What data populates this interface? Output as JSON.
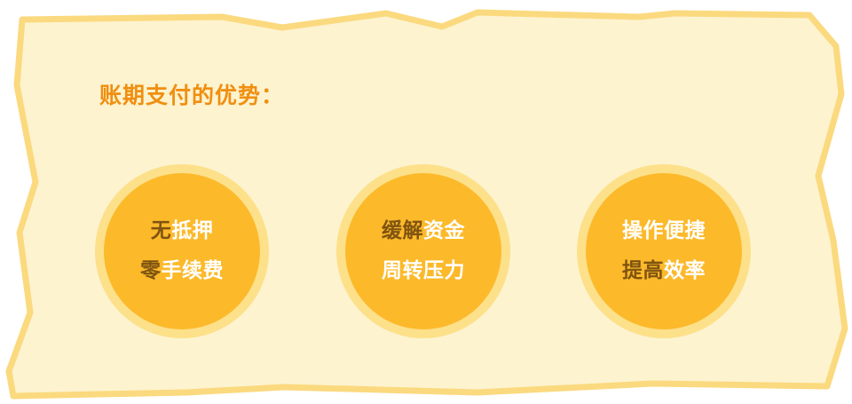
{
  "title": "账期支付的优势：",
  "colors": {
    "paper_fill": "#fdf3cf",
    "paper_border": "#fbd97e",
    "title": "#f08f10",
    "badge_outer": "#fde08a",
    "badge_inner": "#fcb92a",
    "text_dark": "#7f5410",
    "text_light": "#ffffff"
  },
  "benefits": [
    {
      "line1": {
        "dark": "无",
        "light": "抵押"
      },
      "line2": {
        "dark": "零",
        "light": "手续费"
      }
    },
    {
      "line1": {
        "dark": "缓解",
        "light": "资金"
      },
      "line2": {
        "dark": "",
        "light": "周转压力"
      }
    },
    {
      "line1": {
        "dark": "",
        "light": "操作便捷"
      },
      "line2": {
        "dark": "提高",
        "light": "效率"
      }
    }
  ]
}
